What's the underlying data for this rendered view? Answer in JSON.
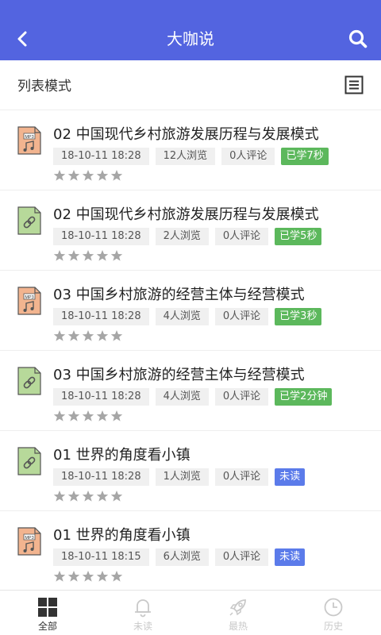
{
  "header": {
    "title": "大咖说",
    "back_icon": "chevron-left-icon",
    "search_icon": "search-icon"
  },
  "mode_bar": {
    "label": "列表模式",
    "toggle_icon": "list-view-icon"
  },
  "items": [
    {
      "type": "mp3",
      "icon": "mp3-file-icon",
      "title": "02 中国现代乡村旅游发展历程与发展模式",
      "date": "18-10-11 18:28",
      "views": "12人浏览",
      "comments": "0人评论",
      "status": "已学7秒",
      "status_type": "learned",
      "rating": 0
    },
    {
      "type": "link",
      "icon": "link-file-icon",
      "title": "02 中国现代乡村旅游发展历程与发展模式",
      "date": "18-10-11 18:28",
      "views": "2人浏览",
      "comments": "0人评论",
      "status": "已学5秒",
      "status_type": "learned",
      "rating": 0
    },
    {
      "type": "mp3",
      "icon": "mp3-file-icon",
      "title": "03 中国乡村旅游的经营主体与经营模式",
      "date": "18-10-11 18:28",
      "views": "4人浏览",
      "comments": "0人评论",
      "status": "已学3秒",
      "status_type": "learned",
      "rating": 0
    },
    {
      "type": "link",
      "icon": "link-file-icon",
      "title": "03 中国乡村旅游的经营主体与经营模式",
      "date": "18-10-11 18:28",
      "views": "4人浏览",
      "comments": "0人评论",
      "status": "已学2分钟",
      "status_type": "learned",
      "rating": 0
    },
    {
      "type": "link",
      "icon": "link-file-icon",
      "title": "01 世界的角度看小镇",
      "date": "18-10-11 18:28",
      "views": "1人浏览",
      "comments": "0人评论",
      "status": "未读",
      "status_type": "unread",
      "rating": 0
    },
    {
      "type": "mp3",
      "icon": "mp3-file-icon",
      "title": "01 世界的角度看小镇",
      "date": "18-10-11 18:15",
      "views": "6人浏览",
      "comments": "0人评论",
      "status": "未读",
      "status_type": "unread",
      "rating": 0
    }
  ],
  "tabs": [
    {
      "label": "全部",
      "icon": "grid-icon",
      "active": true
    },
    {
      "label": "未读",
      "icon": "bell-icon",
      "active": false
    },
    {
      "label": "最热",
      "icon": "rocket-icon",
      "active": false
    },
    {
      "label": "历史",
      "icon": "clock-icon",
      "active": false
    }
  ],
  "colors": {
    "header": "#5364e0",
    "learned": "#5cb85c",
    "unread": "#5b7bea",
    "mp3_icon": "#f2b48f",
    "link_icon": "#b7d99a"
  }
}
